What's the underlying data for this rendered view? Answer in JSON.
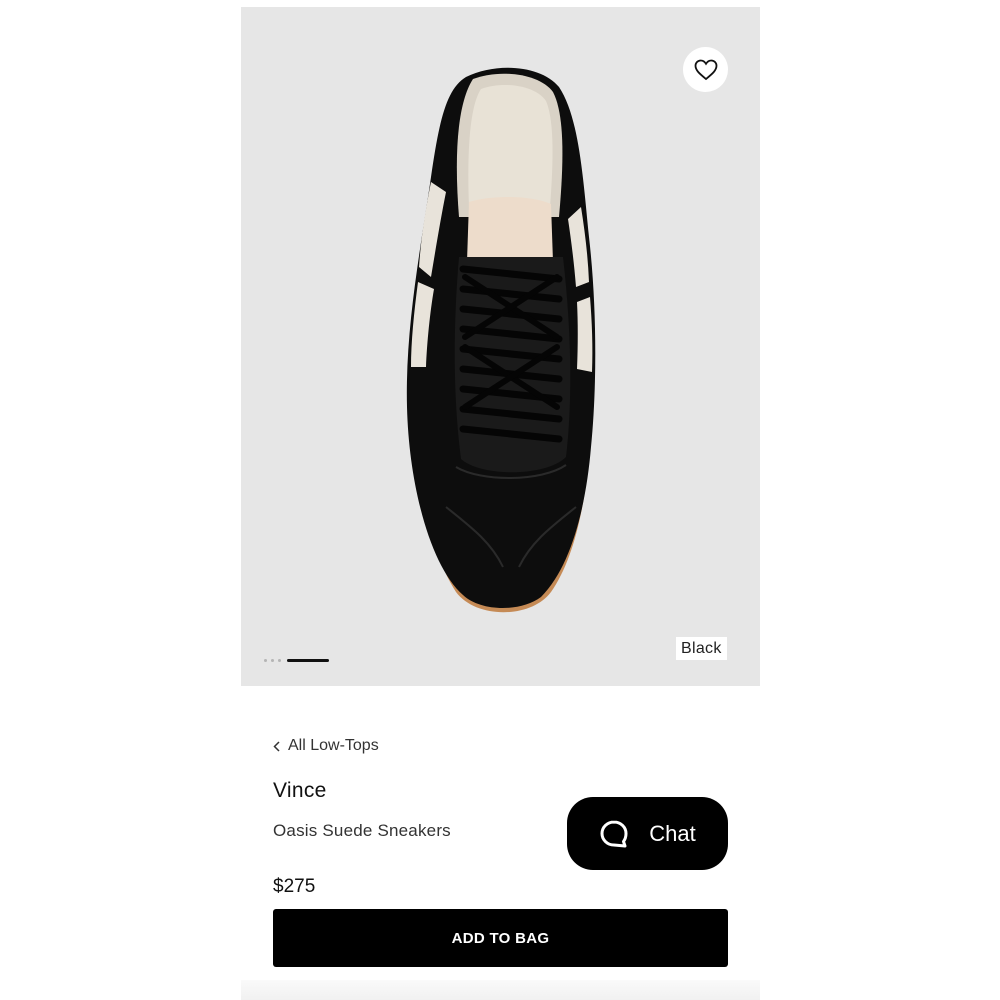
{
  "product": {
    "color_label": "Black",
    "brand": "Vince",
    "name": "Oasis Suede Sneakers",
    "price": "$275",
    "image_count": 4,
    "active_image_index": 3
  },
  "breadcrumb": {
    "label": "All Low-Tops"
  },
  "actions": {
    "add_to_bag_label": "ADD TO BAG",
    "chat_label": "Chat"
  },
  "icons": {
    "wishlist": "heart-icon",
    "back": "chevron-left-icon",
    "chat": "chat-bubble-icon"
  },
  "colors": {
    "image_background": "#e6e6e6",
    "button_background": "#000000",
    "button_text": "#ffffff"
  }
}
